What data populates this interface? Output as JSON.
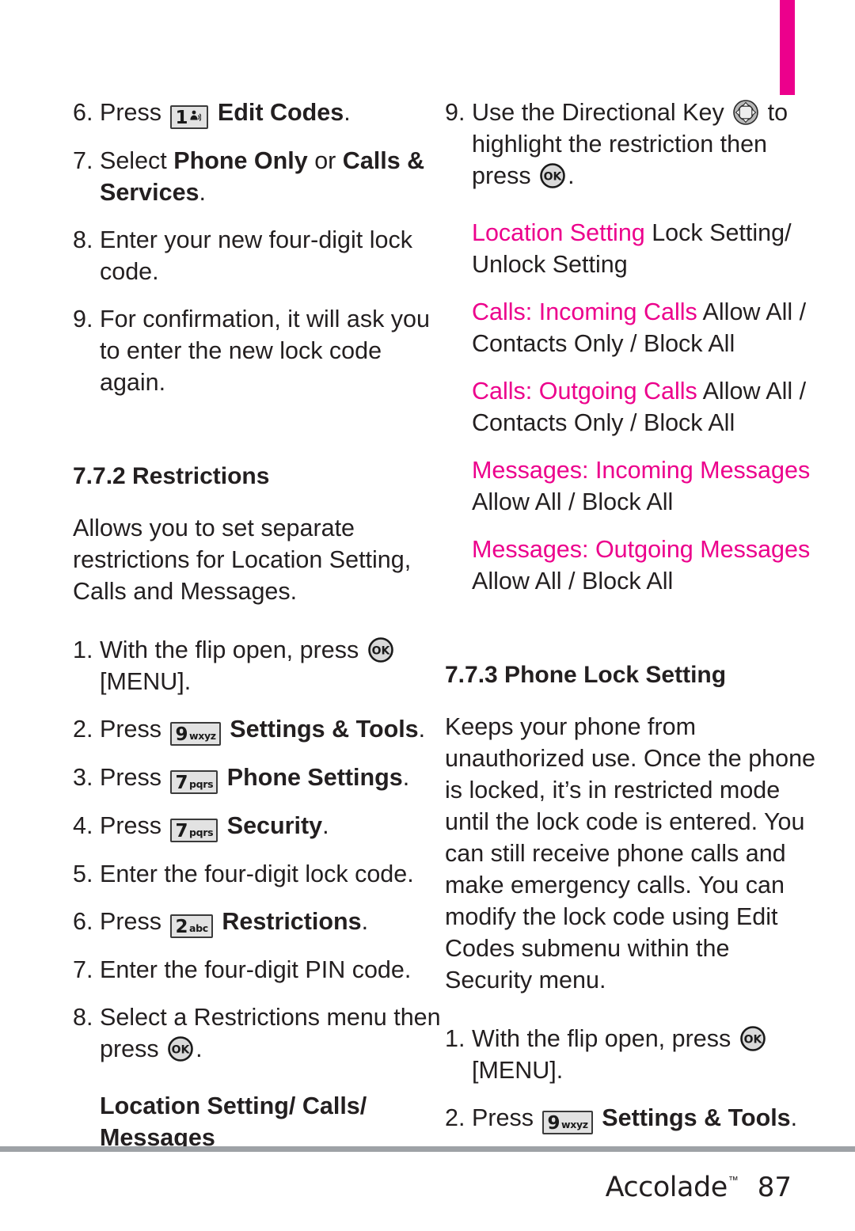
{
  "accent": {
    "color": "#ec008c"
  },
  "left_column": {
    "steps_continued": [
      {
        "num": "6.",
        "prefix": "Press ",
        "key": "1",
        "key_sub": "voicemail-icon",
        "bold_text": "Edit Codes",
        "suffix": "."
      },
      {
        "num": "7.",
        "prefix": "Select ",
        "bold_text": "Phone Only",
        "mid": " or ",
        "bold_text2": "Calls & Services",
        "suffix": "."
      },
      {
        "num": "8.",
        "text": "Enter your new four-digit lock code."
      },
      {
        "num": "9.",
        "text": "For confirmation, it will ask you to enter the new lock code again."
      }
    ],
    "section_heading": "7.7.2 Restrictions",
    "intro": "Allows you to set separate restrictions for Location Setting, Calls and Messages.",
    "steps": [
      {
        "num": "1.",
        "prefix": "With the flip open, press ",
        "key": "OK",
        "suffix": " [MENU]."
      },
      {
        "num": "2.",
        "prefix": "Press ",
        "key": "9",
        "key_sub": "wxyz",
        "bold_text": "Settings & Tools",
        "suffix": "."
      },
      {
        "num": "3.",
        "prefix": "Press ",
        "key": "7",
        "key_sub": "pqrs",
        "bold_text": "Phone Settings",
        "suffix": "."
      },
      {
        "num": "4.",
        "prefix": "Press ",
        "key": "7",
        "key_sub": "pqrs",
        "bold_text": "Security",
        "suffix": "."
      },
      {
        "num": "5.",
        "text": "Enter the four-digit lock code."
      },
      {
        "num": "6.",
        "prefix": "Press ",
        "key": "2",
        "key_sub": "abc",
        "bold_text": "Restrictions",
        "suffix": "."
      },
      {
        "num": "7.",
        "text": "Enter the four-digit PIN code."
      },
      {
        "num": "8.",
        "prefix": "Select a Restrictions menu then press ",
        "key": "OK",
        "suffix": "."
      }
    ],
    "menu_list": "Location Setting/ Calls/ Messages"
  },
  "right_column": {
    "step9": {
      "num": "9.",
      "prefix": "Use the Directional Key ",
      "key": "directional-key",
      "mid": " to highlight the restriction then press ",
      "key2": "OK",
      "suffix": "."
    },
    "restrictions": [
      {
        "label": "Location Setting",
        "values": " Lock Setting/ Unlock Setting"
      },
      {
        "label": "Calls: Incoming Calls",
        "values": " Allow All / Contacts Only / Block All"
      },
      {
        "label": "Calls: Outgoing Calls",
        "values": " Allow All / Contacts Only / Block All"
      },
      {
        "label": "Messages: Incoming Messages",
        "values": "Allow All / Block All"
      },
      {
        "label": "Messages: Outgoing Messages",
        "values": "Allow All / Block All"
      }
    ],
    "section_heading": "7.7.3 Phone Lock Setting",
    "description": "Keeps your phone from unauthorized use. Once the phone is locked, it’s in restricted mode until the lock code is entered. You can still receive phone calls and make emergency calls. You can modify the lock code using Edit Codes submenu within the Security menu.",
    "steps": [
      {
        "num": "1.",
        "prefix": "With the flip open, press ",
        "key": "OK",
        "suffix": " [MENU]."
      },
      {
        "num": "2.",
        "prefix": "Press ",
        "key": "9",
        "key_sub": "wxyz",
        "bold_text": "Settings & Tools",
        "suffix": "."
      }
    ]
  },
  "footer": {
    "brand": "Accolade",
    "trademark": "™",
    "page_number": "87"
  }
}
